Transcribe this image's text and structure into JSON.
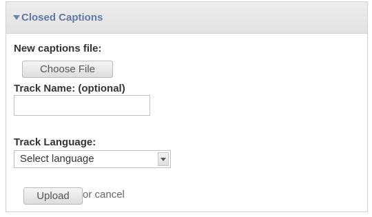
{
  "panel": {
    "title": "Closed Captions",
    "collapse_icon": "triangle-down-icon"
  },
  "form": {
    "captions_file_label": "New captions file:",
    "choose_file_label": "Choose File",
    "track_name_label": "Track Name: (optional)",
    "track_name_value": "",
    "track_language_label": "Track Language:",
    "track_language_selected": "Select language",
    "upload_label": "Upload",
    "cancel_text": "or cancel"
  }
}
